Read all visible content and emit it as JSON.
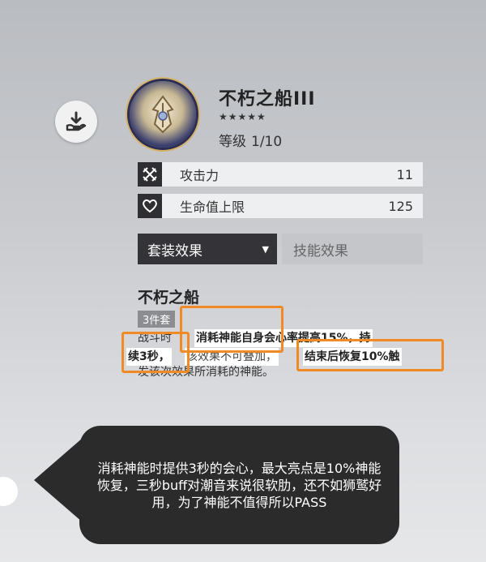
{
  "item": {
    "title": "不朽之船III",
    "stars": "★★★★★",
    "level_label": "等级",
    "level_value": "1/10"
  },
  "stats": [
    {
      "icon": "crossed-swords-icon",
      "label": "攻击力",
      "value": "11"
    },
    {
      "icon": "heart-icon",
      "label": "生命值上限",
      "value": "125"
    }
  ],
  "tabs": {
    "active_label": "套装效果",
    "active_arrow": "▼",
    "inactive_label": "技能效果"
  },
  "set": {
    "name": "不朽之船",
    "pieces": "3件套",
    "desc_line1": "战斗时",
    "desc_frag1": "消耗神能自身会心率提高15%，持",
    "desc_frag2": "续3秒，",
    "desc_frag3": "该效果不可叠加，",
    "desc_frag4": "结束后恢复10%触",
    "desc_line3": "发该次效果所消耗的神能。"
  },
  "annotation": {
    "text": "消耗神能时提供3秒的会心，最大亮点是10%神能恢复，三秒buff对潮音来说很软肋，还不如狮鹫好用，为了神能不值得所以PASS"
  },
  "colors": {
    "highlight_box": "#f08a24",
    "bubble": "#2b2b2b",
    "tab_active": "#333338"
  }
}
